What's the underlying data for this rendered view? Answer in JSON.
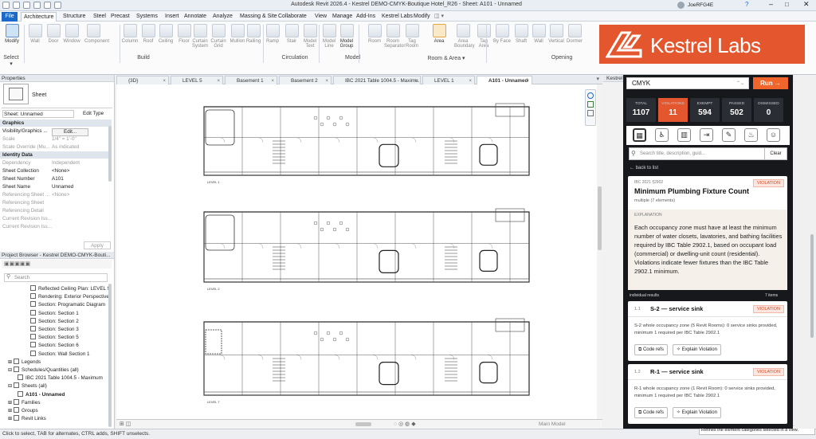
{
  "app": {
    "title": "Autodesk Revit 2026.4 - Kestrel DEMO-CMYK-Boutique Hotel_R26 - Sheet: A101 - Unnamed",
    "user": "JoeRFG4E"
  },
  "ribbon": {
    "tabs": [
      "File",
      "Architecture",
      "Structure",
      "Steel",
      "Precast",
      "Systems",
      "Insert",
      "Annotate",
      "Analyze",
      "Massing & Site",
      "Collaborate",
      "View",
      "Manage",
      "Add-Ins",
      "Kestrel Labs",
      "Modify"
    ],
    "active_tab": "Architecture",
    "tools": [
      {
        "label": "Modify"
      },
      {
        "label": "Wall"
      },
      {
        "label": "Door"
      },
      {
        "label": "Window"
      },
      {
        "label": "Component"
      },
      {
        "label": "Column"
      },
      {
        "label": "Roof"
      },
      {
        "label": "Ceiling"
      },
      {
        "label": "Floor"
      },
      {
        "label": "Curtain System"
      },
      {
        "label": "Curtain Grid"
      },
      {
        "label": "Mullion"
      },
      {
        "label": "Railing"
      },
      {
        "label": "Ramp"
      },
      {
        "label": "Stair"
      },
      {
        "label": "Model Text"
      },
      {
        "label": "Model Line"
      },
      {
        "label": "Model Group"
      },
      {
        "label": "Room"
      },
      {
        "label": "Room Separator"
      },
      {
        "label": "Tag Room"
      },
      {
        "label": "Area"
      },
      {
        "label": "Area Boundary"
      },
      {
        "label": "Tag Area"
      },
      {
        "label": "By Face"
      },
      {
        "label": "Shaft"
      },
      {
        "label": "Wall"
      },
      {
        "label": "Vertical"
      },
      {
        "label": "Dormer"
      }
    ],
    "groups": [
      "Select ▾",
      "Build",
      "Circulation",
      "Model",
      "Room & Area ▾",
      "Opening"
    ],
    "logo_text": "Kestrel Labs"
  },
  "properties": {
    "title": "Properties",
    "type_name": "Sheet",
    "selector": "Sheet: Unnamed",
    "edit_type": "Edit Type",
    "sections": {
      "graphics": "Graphics",
      "identity": "Identity Data"
    },
    "rows": [
      {
        "k": "Visibility/Graphics ...",
        "v": "Edit..."
      },
      {
        "k": "Scale",
        "v": "1/4\" = 1'-0\""
      },
      {
        "k": "Scale Override (Mu...",
        "v": "As indicated"
      },
      {
        "k": "Dependency",
        "v": "Independent"
      },
      {
        "k": "Sheet Collection",
        "v": "<None>"
      },
      {
        "k": "Sheet Number",
        "v": "A101"
      },
      {
        "k": "Sheet Name",
        "v": "Unnamed"
      },
      {
        "k": "Referencing Sheet ...",
        "v": "<None>"
      },
      {
        "k": "Referencing Sheet",
        "v": ""
      },
      {
        "k": "Referencing Detail",
        "v": ""
      },
      {
        "k": "Current Revision Iss...",
        "v": ""
      },
      {
        "k": "Current Revision Iss...",
        "v": ""
      }
    ],
    "apply": "Apply"
  },
  "project_browser": {
    "title": "Project Browser - Kestrel DEMO-CMYK-Bouti...",
    "search_placeholder": "Search",
    "items": [
      "Reflected Ceiling Plan: LEVEL 9",
      "Rendering: Exterior Perspective",
      "Section: Programatic Diagram",
      "Section: Section 1",
      "Section: Section 2",
      "Section: Section 3",
      "Section: Section 5",
      "Section: Section 6",
      "Section: Wall Section 1",
      "Legends",
      "Schedules/Quantities (all)",
      "IBC 2021 Table 1004.5 - Maximum",
      "Sheets (all)",
      "A101 - Unnamed",
      "Families",
      "Groups",
      "Revit Links"
    ]
  },
  "view_tabs": [
    "{3D}",
    "LEVEL 5",
    "Basement 1",
    "Basement 2",
    "IBC 2021 Table 1004.5 - Maximu...",
    "LEVEL 1",
    "A101 - Unnamed"
  ],
  "sheet": {
    "level_labels": [
      "LEVEL 1",
      "LEVEL 2",
      "LEVEL 7"
    ]
  },
  "viewbar": {
    "workset": "Main Model"
  },
  "statusbar": {
    "text": "Click to select, TAB for alternates, CTRL adds, SHIFT unselects.",
    "tooltip": "Refines the element categories selected in a view."
  },
  "kestrel": {
    "panel_title": "Kestrel Labs",
    "dropdown_value": "CMYK",
    "run_label": "Run  →",
    "stats": [
      {
        "label": "TOTAL",
        "value": "1107"
      },
      {
        "label": "VIOLATIONS",
        "value": "11"
      },
      {
        "label": "EXEMPT",
        "value": "594"
      },
      {
        "label": "PASSED",
        "value": "502"
      },
      {
        "label": "DISMISSED",
        "value": "0"
      }
    ],
    "category_icons": [
      "building-icon",
      "accessibility-icon",
      "hotel-icon",
      "exit-icon",
      "document-icon",
      "fire-icon",
      "people-icon"
    ],
    "search_placeholder": "Search title, description, guid...",
    "clear_label": "Clear",
    "back_label": "back to list",
    "rule": {
      "code": "IBC 2021 §2902",
      "badge": "VIOLATION",
      "title": "Minimum Plumbing Fixture Count",
      "subtitle": "multiple (7 elements)",
      "explanation_label": "EXPLANATION",
      "explanation": "Each occupancy zone must have at least the minimum number of water closets, lavatories, and bathing facilities required by IBC Table 2902.1, based on occupant load (commercial) or dwelling-unit count (residential). Violations indicate fewer fixtures than the IBC Table 2902.1 minimum."
    },
    "results_label": "individual results",
    "results_count": "7 items",
    "results": [
      {
        "num": "1.1",
        "title": "S-2 — service sink",
        "badge": "VIOLATION",
        "desc": "S-2 whole occupancy zone (5 Revit Rooms): 0 service sinks provided, minimum 1 required per IBC Table 2902.1",
        "btn1": "Code refs",
        "btn2": "Explain Violation"
      },
      {
        "num": "1.2",
        "title": "R-1 — service sink",
        "badge": "VIOLATION",
        "desc": "R-1 whole occupancy zone (1 Revit Room): 0 service sinks provided, minimum 1 required per IBC Table 2902.1",
        "btn1": "Code refs",
        "btn2": "Explain Violation"
      }
    ]
  },
  "colors": {
    "accent": "#e4572e",
    "revit_blue": "#1b6ac9",
    "panel_dark": "#16181c"
  }
}
